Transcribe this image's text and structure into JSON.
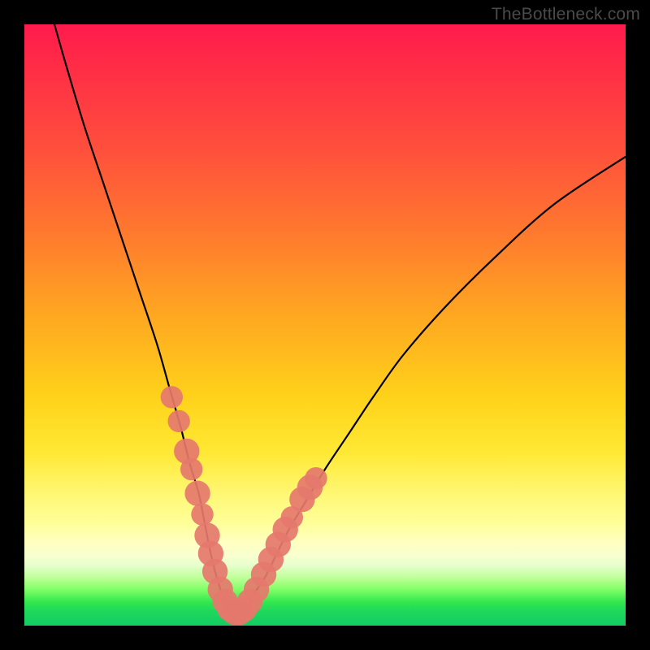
{
  "watermark": "TheBottleneck.com",
  "colors": {
    "frame": "#000000",
    "curve": "#000000",
    "markers": "#e5786d",
    "gradient_top": "#ff1a4d",
    "gradient_mid1": "#ff7a2e",
    "gradient_mid2": "#ffe833",
    "gradient_mid3": "#ffffbf",
    "gradient_bottom": "#13cc66"
  },
  "chart_data": {
    "type": "line",
    "title": "",
    "xlabel": "",
    "ylabel": "",
    "xlim": [
      0,
      100
    ],
    "ylim": [
      0,
      100
    ],
    "grid": false,
    "legend": false,
    "series": [
      {
        "name": "bottleneck-curve",
        "x": [
          5,
          7,
          10,
          13,
          16,
          19,
          22,
          24,
          26,
          27.5,
          29,
          30,
          31,
          32,
          33,
          34,
          35,
          36,
          37,
          38,
          40,
          42,
          44,
          47,
          50,
          54,
          58,
          63,
          70,
          78,
          88,
          100
        ],
        "y": [
          100,
          93,
          83,
          74,
          65,
          56,
          47,
          40,
          33,
          27,
          22,
          17,
          12,
          8,
          5,
          3,
          2,
          2,
          3,
          5,
          8,
          12,
          16,
          21,
          26,
          32,
          38,
          45,
          53,
          61,
          70,
          78
        ]
      }
    ],
    "markers": [
      {
        "name": "left-band-top",
        "x": 24.5,
        "y": 38,
        "r": 1.3
      },
      {
        "name": "left-band-upper",
        "x": 25.7,
        "y": 34,
        "r": 1.3
      },
      {
        "name": "left-band-a",
        "x": 27.0,
        "y": 29,
        "r": 1.6
      },
      {
        "name": "left-band-b",
        "x": 27.8,
        "y": 26,
        "r": 1.3
      },
      {
        "name": "left-band-c",
        "x": 28.8,
        "y": 22,
        "r": 1.6
      },
      {
        "name": "left-band-d",
        "x": 29.6,
        "y": 18.5,
        "r": 1.3
      },
      {
        "name": "left-band-e",
        "x": 30.4,
        "y": 15,
        "r": 1.6
      },
      {
        "name": "left-band-f",
        "x": 31.0,
        "y": 12,
        "r": 1.6
      },
      {
        "name": "left-band-g",
        "x": 31.7,
        "y": 9,
        "r": 1.6
      },
      {
        "name": "valley-a",
        "x": 32.6,
        "y": 6,
        "r": 1.6
      },
      {
        "name": "valley-b",
        "x": 33.4,
        "y": 4,
        "r": 1.6
      },
      {
        "name": "valley-c",
        "x": 34.2,
        "y": 2.8,
        "r": 1.6
      },
      {
        "name": "valley-d",
        "x": 35.0,
        "y": 2.2,
        "r": 1.6
      },
      {
        "name": "valley-e",
        "x": 35.8,
        "y": 2.2,
        "r": 1.6
      },
      {
        "name": "valley-f",
        "x": 36.6,
        "y": 2.8,
        "r": 1.6
      },
      {
        "name": "valley-g",
        "x": 37.5,
        "y": 4,
        "r": 1.6
      },
      {
        "name": "right-band-a",
        "x": 38.6,
        "y": 6,
        "r": 1.6
      },
      {
        "name": "right-band-b",
        "x": 39.8,
        "y": 8.5,
        "r": 1.6
      },
      {
        "name": "right-band-c",
        "x": 41.0,
        "y": 11,
        "r": 1.6
      },
      {
        "name": "right-band-d",
        "x": 42.2,
        "y": 13.5,
        "r": 1.6
      },
      {
        "name": "right-band-e",
        "x": 43.4,
        "y": 16,
        "r": 1.6
      },
      {
        "name": "right-band-f",
        "x": 44.5,
        "y": 18,
        "r": 1.3
      },
      {
        "name": "right-band-top-a",
        "x": 46.2,
        "y": 21,
        "r": 1.6
      },
      {
        "name": "right-band-top-b",
        "x": 47.5,
        "y": 23,
        "r": 1.6
      },
      {
        "name": "right-band-top-c",
        "x": 48.5,
        "y": 24.5,
        "r": 1.3
      }
    ]
  }
}
